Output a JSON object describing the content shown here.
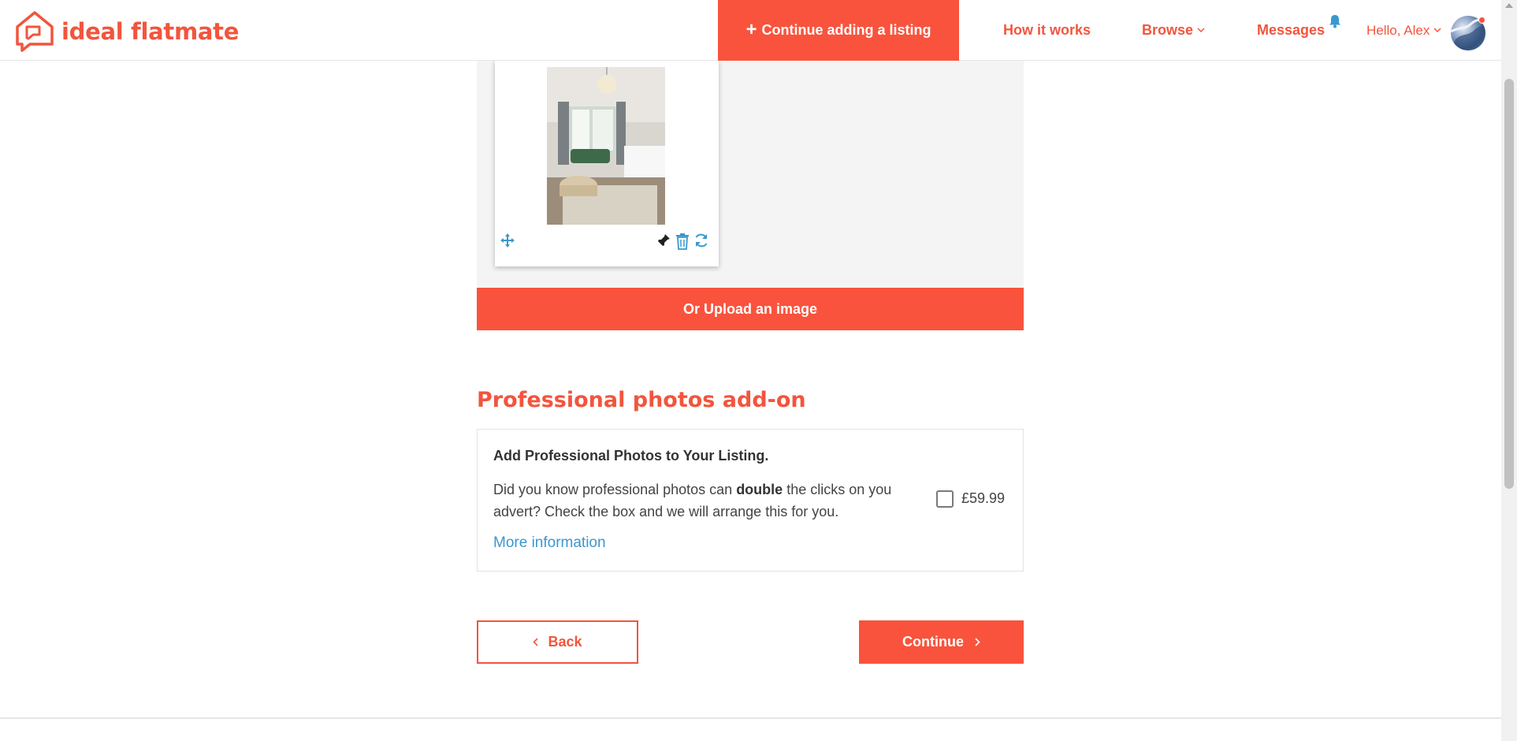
{
  "brand": {
    "name": "ideal flatmate",
    "accent": "#f9533d",
    "link_color": "#3a97cf"
  },
  "header": {
    "cta_label": "Continue adding a listing",
    "cta_icon": "plus-icon",
    "nav": {
      "how_it_works": "How it works",
      "browse": "Browse",
      "messages": "Messages",
      "user_greeting": "Hello, Alex"
    },
    "icons": [
      "bell-icon",
      "chevron-down-icon",
      "avatar"
    ]
  },
  "gallery": {
    "card_tools": [
      "move-icon",
      "pin-icon",
      "trash-icon",
      "rotate-icon"
    ],
    "upload_label": "Or Upload an image"
  },
  "addon": {
    "section_title": "Professional photos add-on",
    "heading": "Add Professional Photos to Your Listing.",
    "desc_before": "Did you know professional photos can ",
    "desc_bold": "double",
    "desc_after": " the clicks on you advert? Check the box and we will arrange this for you.",
    "more_info": "More information",
    "checked": false,
    "price": "£59.99"
  },
  "footer_nav": {
    "back_label": "Back",
    "continue_label": "Continue"
  }
}
